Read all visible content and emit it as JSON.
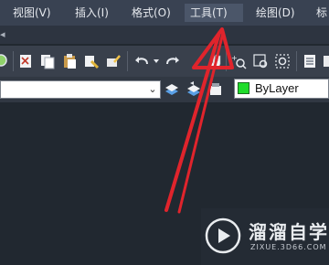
{
  "menubar": {
    "items": [
      {
        "label": "视图(V)"
      },
      {
        "label": "插入(I)"
      },
      {
        "label": "格式(O)"
      },
      {
        "label": "工具(T)"
      },
      {
        "label": "绘图(D)"
      },
      {
        "label": "标"
      }
    ],
    "active_item": "工具(T)"
  },
  "toolbar": {
    "icons": [
      "zoom-icon",
      "cut-icon",
      "copy-icon",
      "paste-icon",
      "match-properties-icon",
      "brush-icon",
      "undo-icon",
      "dropdown-icon",
      "redo-icon",
      "pan-hand-icon",
      "zoom-realtime-icon",
      "zoom-window-icon",
      "zoom-previous-icon",
      "properties-icon",
      "design-center-icon"
    ]
  },
  "properties_bar": {
    "layer_value": "",
    "color_value": "ByLayer",
    "color_swatch": "#1fdc2a"
  },
  "annotation": {
    "arrow_color": "#e0242c"
  },
  "watermark": {
    "title": "溜溜自学",
    "url": "ZIXUE.3D66.COM"
  }
}
